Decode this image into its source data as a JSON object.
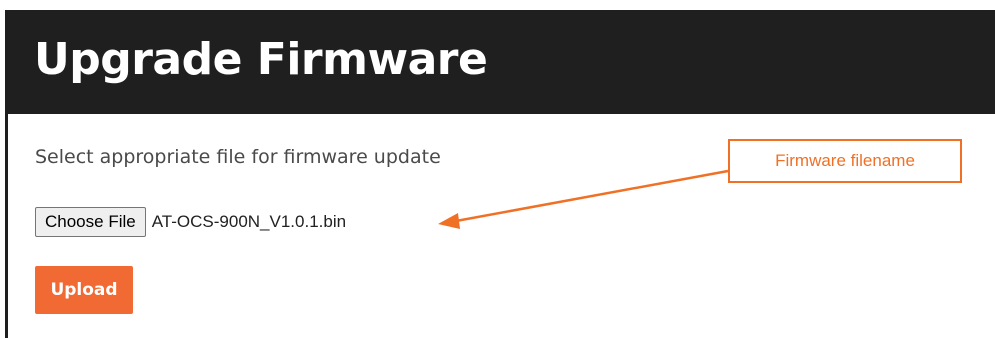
{
  "page": {
    "title": "Upgrade Firmware",
    "instruction": "Select appropriate file for firmware update"
  },
  "file_input": {
    "button_label": "Choose File",
    "selected_file": "AT-OCS-900N_V1.0.1.bin"
  },
  "actions": {
    "upload_label": "Upload"
  },
  "annotation": {
    "label": "Firmware filename",
    "color": "#f07026"
  },
  "colors": {
    "header_bg": "#1f1f1f",
    "accent": "#f26a33"
  }
}
